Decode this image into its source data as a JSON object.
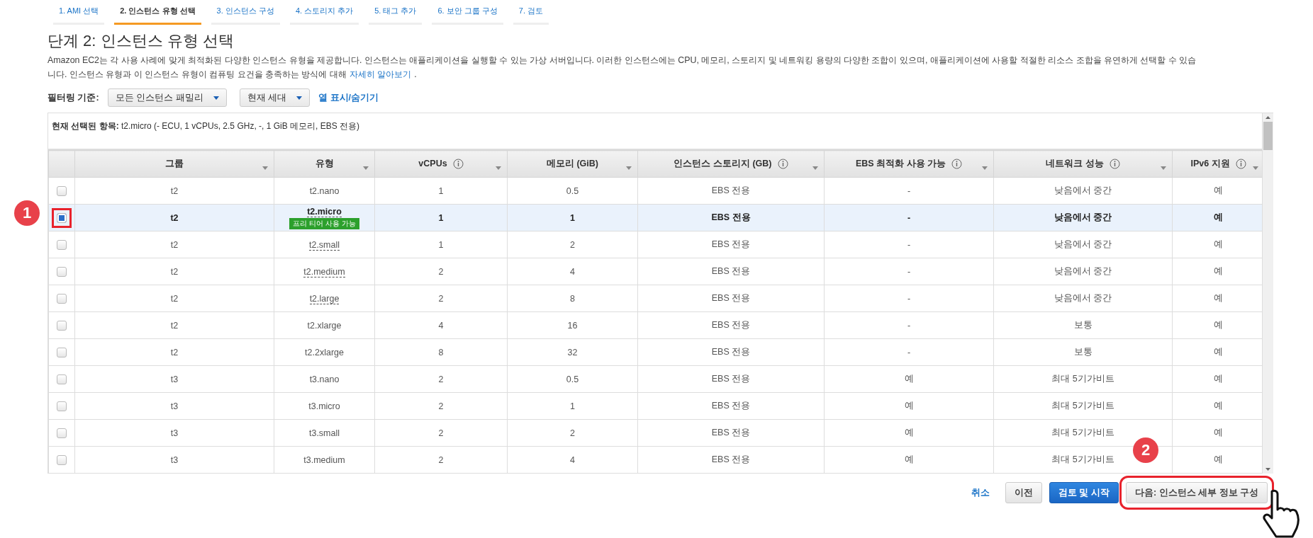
{
  "steps": [
    {
      "label": "1. AMI 선택",
      "selected": false
    },
    {
      "label": "2. 인스턴스 유형 선택",
      "selected": true
    },
    {
      "label": "3. 인스턴스 구성",
      "selected": false
    },
    {
      "label": "4. 스토리지 추가",
      "selected": false
    },
    {
      "label": "5. 태그 추가",
      "selected": false
    },
    {
      "label": "6. 보안 그룹 구성",
      "selected": false
    },
    {
      "label": "7. 검토",
      "selected": false
    }
  ],
  "title": "단계 2: 인스턴스 유형 선택",
  "description": {
    "line_1": "Amazon EC2는 각 사용 사례에 맞게 최적화된 다양한 인스턴스 유형을 제공합니다. 인스턴스는 애플리케이션을 실행할 수 있는 가상 서버입니다. 이러한 인스턴스에는 CPU, 메모리, 스토리지 및 네트워킹 용량의 다양한 조합이 있으며, 애플리케이션에 사용할 적절한 리소스 조합을 유연하게 선택할 수 있습",
    "line_2": "니다. 인스턴스 유형과 이 인스턴스 유형이 컴퓨팅 요건을 충족하는 방식에 대해",
    "link": "자세히 알아보기",
    "end": "."
  },
  "filter": {
    "label": "필터링 기준:",
    "family": "모든 인스턴스 패밀리",
    "generation": "현재 세대",
    "columns_link": "열 표시/숨기기"
  },
  "current_selection": {
    "label": "현재 선택된 항목:",
    "value": "t2.micro (- ECU, 1 vCPUs, 2.5 GHz, -, 1 GiB 메모리, EBS 전용)"
  },
  "table": {
    "columns": [
      {
        "label": "그룹",
        "info": false
      },
      {
        "label": "유형",
        "info": false
      },
      {
        "label": "vCPUs",
        "info": true
      },
      {
        "label": "메모리 (GiB)",
        "info": false
      },
      {
        "label": "인스턴스 스토리지 (GB)",
        "info": true
      },
      {
        "label": "EBS 최적화 사용 가능",
        "info": true
      },
      {
        "label": "네트워크 성능",
        "info": true
      },
      {
        "label": "IPv6 지원",
        "info": true
      }
    ],
    "rows": [
      {
        "selected": false,
        "cells": [
          "t2",
          "t2.nano",
          "1",
          "0.5",
          "EBS 전용",
          "-",
          "낮음에서 중간",
          "예"
        ],
        "dotted_type": false
      },
      {
        "selected": true,
        "cells": [
          "t2",
          "t2.micro",
          "1",
          "1",
          "EBS 전용",
          "-",
          "낮음에서 중간",
          "예"
        ],
        "dotted_type": true,
        "badge": "프리 티어 사용 가능"
      },
      {
        "selected": false,
        "cells": [
          "t2",
          "t2.small",
          "1",
          "2",
          "EBS 전용",
          "-",
          "낮음에서 중간",
          "예"
        ],
        "dotted_type": true
      },
      {
        "selected": false,
        "cells": [
          "t2",
          "t2.medium",
          "2",
          "4",
          "EBS 전용",
          "-",
          "낮음에서 중간",
          "예"
        ],
        "dotted_type": true
      },
      {
        "selected": false,
        "cells": [
          "t2",
          "t2.large",
          "2",
          "8",
          "EBS 전용",
          "-",
          "낮음에서 중간",
          "예"
        ],
        "dotted_type": true
      },
      {
        "selected": false,
        "cells": [
          "t2",
          "t2.xlarge",
          "4",
          "16",
          "EBS 전용",
          "-",
          "보통",
          "예"
        ],
        "dotted_type": false
      },
      {
        "selected": false,
        "cells": [
          "t2",
          "t2.2xlarge",
          "8",
          "32",
          "EBS 전용",
          "-",
          "보통",
          "예"
        ],
        "dotted_type": false
      },
      {
        "selected": false,
        "cells": [
          "t3",
          "t3.nano",
          "2",
          "0.5",
          "EBS 전용",
          "예",
          "최대 5기가비트",
          "예"
        ],
        "dotted_type": false
      },
      {
        "selected": false,
        "cells": [
          "t3",
          "t3.micro",
          "2",
          "1",
          "EBS 전용",
          "예",
          "최대 5기가비트",
          "예"
        ],
        "dotted_type": false
      },
      {
        "selected": false,
        "cells": [
          "t3",
          "t3.small",
          "2",
          "2",
          "EBS 전용",
          "예",
          "최대 5기가비트",
          "예"
        ],
        "dotted_type": false
      },
      {
        "selected": false,
        "cells": [
          "t3",
          "t3.medium",
          "2",
          "4",
          "EBS 전용",
          "예",
          "최대 5기가비트",
          "예"
        ],
        "dotted_type": false
      }
    ]
  },
  "buttons": [
    {
      "label": "취소",
      "kind": "link"
    },
    {
      "label": "이전",
      "kind": "default"
    },
    {
      "label": "검토 및 시작",
      "kind": "primary"
    },
    {
      "label": "다음: 인스턴스 세부 정보 구성",
      "kind": "highlighted"
    }
  ],
  "callouts": [
    "1",
    "2"
  ]
}
